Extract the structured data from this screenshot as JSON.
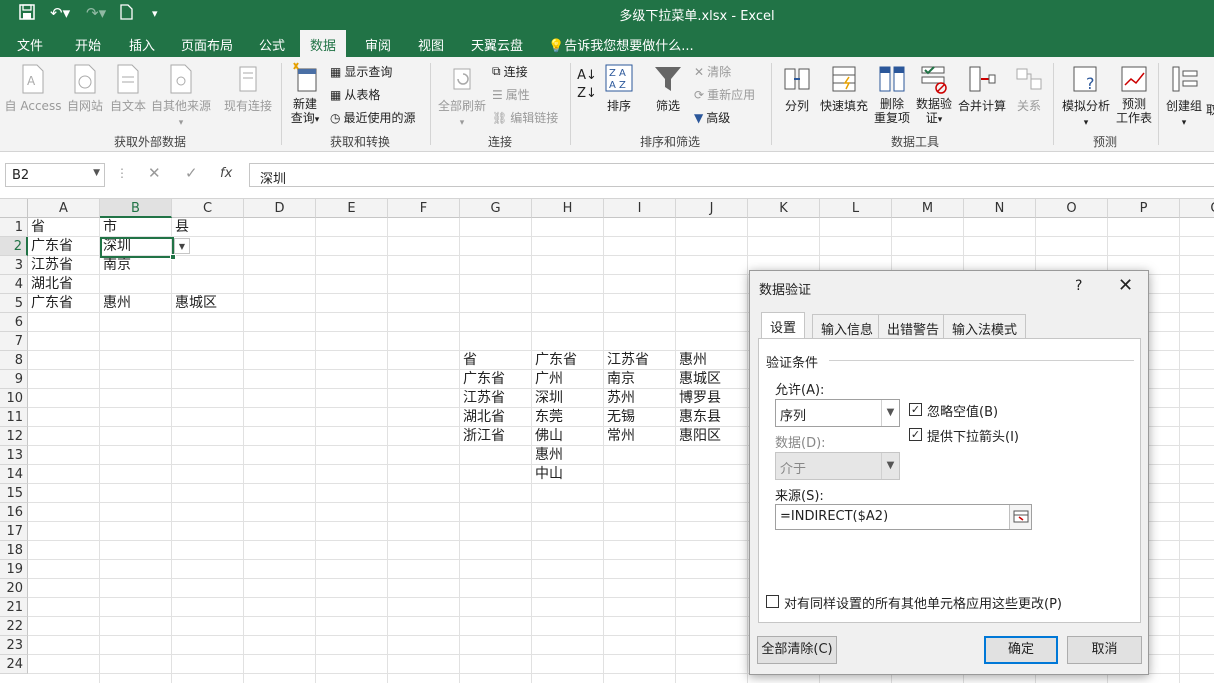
{
  "titlebar": {
    "title": "多级下拉菜单.xlsx - Excel"
  },
  "tabs": [
    "文件",
    "开始",
    "插入",
    "页面布局",
    "公式",
    "数据",
    "审阅",
    "视图",
    "天翼云盘"
  ],
  "active_tab": "数据",
  "tell_me": "告诉我您想要做什么...",
  "ribbon": {
    "external": {
      "label": "获取外部数据",
      "buttons": [
        "自 Access",
        "自网站",
        "自文本",
        "自其他来源",
        "现有连接"
      ]
    },
    "transform": {
      "label": "获取和转换",
      "new_query": "新建\n查询",
      "show_query": "显示查询",
      "from_table": "从表格",
      "recent_sources": "最近使用的源"
    },
    "connections": {
      "label": "连接",
      "refresh_all": "全部刷新",
      "connections": "连接",
      "properties": "属性",
      "edit_links": "编辑链接"
    },
    "sort_filter": {
      "label": "排序和筛选",
      "sort": "排序",
      "filter": "筛选",
      "clear": "清除",
      "reapply": "重新应用",
      "advanced": "高级"
    },
    "data_tools": {
      "label": "数据工具",
      "split": "分列",
      "flash_fill": "快速填充",
      "remove_dup": "删除\n重复项",
      "validation": "数据验\n证",
      "consolidate": "合并计算",
      "relations": "关系"
    },
    "forecast": {
      "label": "预测",
      "whatif": "模拟分析",
      "forecast_sheet": "预测\n工作表"
    },
    "outline": {
      "group": "创建组",
      "cut": "取"
    }
  },
  "formula_bar": {
    "name_box": "B2",
    "formula": "深圳"
  },
  "columns": [
    "A",
    "B",
    "C",
    "D",
    "E",
    "F",
    "G",
    "H",
    "I",
    "J",
    "K",
    "L",
    "M",
    "N",
    "O",
    "P",
    "Q"
  ],
  "rows": [
    "1",
    "2",
    "3",
    "4",
    "5",
    "6",
    "7",
    "8",
    "9",
    "10",
    "11",
    "12",
    "13",
    "14",
    "15",
    "16",
    "17",
    "18",
    "19",
    "20",
    "21",
    "22",
    "23",
    "24"
  ],
  "cells": {
    "A1": "省",
    "B1": "市",
    "C1": "县",
    "A2": "广东省",
    "B2": "深圳",
    "A3": "江苏省",
    "B3": "南京",
    "A4": "湖北省",
    "A5": "广东省",
    "B5": "惠州",
    "C5": "惠城区",
    "G8": "省",
    "H8": "广东省",
    "I8": "江苏省",
    "J8": "惠州",
    "G9": "广东省",
    "H9": "广州",
    "I9": "南京",
    "J9": "惠城区",
    "G10": "江苏省",
    "H10": "深圳",
    "I10": "苏州",
    "J10": "博罗县",
    "G11": "湖北省",
    "H11": "东莞",
    "I11": "无锡",
    "J11": "惠东县",
    "G12": "浙江省",
    "H12": "佛山",
    "I12": "常州",
    "J12": "惠阳区",
    "H13": "惠州",
    "H14": "中山"
  },
  "dialog": {
    "title": "数据验证",
    "help": "?",
    "close": "✕",
    "tabs": [
      "设置",
      "输入信息",
      "出错警告",
      "输入法模式"
    ],
    "criteria_title": "验证条件",
    "allow_label": "允许(A):",
    "allow_value": "序列",
    "ignore_blank": "忽略空值(B)",
    "in_cell_dropdown": "提供下拉箭头(I)",
    "data_label": "数据(D):",
    "data_value": "介于",
    "source_label": "来源(S):",
    "source_value": "=INDIRECT($A2)",
    "apply_all": "对有同样设置的所有其他单元格应用这些更改(P)",
    "clear_all": "全部清除(C)",
    "ok": "确定",
    "cancel": "取消"
  },
  "colors": {
    "excel_green": "#217346",
    "ribbon_bg": "#f3f3f3"
  }
}
